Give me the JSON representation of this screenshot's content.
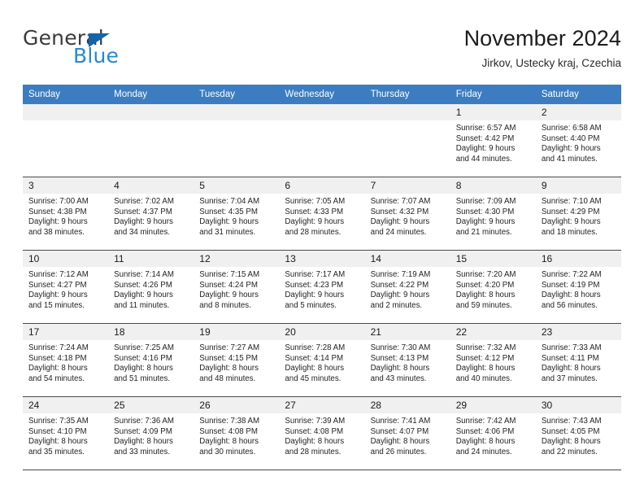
{
  "brand": {
    "name_part1": "General",
    "name_part2": "Blue",
    "accent_color": "#2389d4",
    "triangle_color": "#1464aa"
  },
  "header": {
    "title": "November 2024",
    "subtitle": "Jirkov, Ustecky kraj, Czechia"
  },
  "calendar": {
    "header_bg": "#3b7dc0",
    "daynum_bg": "#f0f0f0",
    "weekdays": [
      "Sunday",
      "Monday",
      "Tuesday",
      "Wednesday",
      "Thursday",
      "Friday",
      "Saturday"
    ],
    "labels": {
      "sunrise": "Sunrise:",
      "sunset": "Sunset:",
      "daylight": "Daylight:"
    },
    "weeks": [
      [
        {
          "day": "",
          "empty": true
        },
        {
          "day": "",
          "empty": true
        },
        {
          "day": "",
          "empty": true
        },
        {
          "day": "",
          "empty": true
        },
        {
          "day": "",
          "empty": true
        },
        {
          "day": "1",
          "sunrise": "Sunrise: 6:57 AM",
          "sunset": "Sunset: 4:42 PM",
          "daylight_line1": "Daylight: 9 hours",
          "daylight_line2": "and 44 minutes."
        },
        {
          "day": "2",
          "sunrise": "Sunrise: 6:58 AM",
          "sunset": "Sunset: 4:40 PM",
          "daylight_line1": "Daylight: 9 hours",
          "daylight_line2": "and 41 minutes."
        }
      ],
      [
        {
          "day": "3",
          "sunrise": "Sunrise: 7:00 AM",
          "sunset": "Sunset: 4:38 PM",
          "daylight_line1": "Daylight: 9 hours",
          "daylight_line2": "and 38 minutes."
        },
        {
          "day": "4",
          "sunrise": "Sunrise: 7:02 AM",
          "sunset": "Sunset: 4:37 PM",
          "daylight_line1": "Daylight: 9 hours",
          "daylight_line2": "and 34 minutes."
        },
        {
          "day": "5",
          "sunrise": "Sunrise: 7:04 AM",
          "sunset": "Sunset: 4:35 PM",
          "daylight_line1": "Daylight: 9 hours",
          "daylight_line2": "and 31 minutes."
        },
        {
          "day": "6",
          "sunrise": "Sunrise: 7:05 AM",
          "sunset": "Sunset: 4:33 PM",
          "daylight_line1": "Daylight: 9 hours",
          "daylight_line2": "and 28 minutes."
        },
        {
          "day": "7",
          "sunrise": "Sunrise: 7:07 AM",
          "sunset": "Sunset: 4:32 PM",
          "daylight_line1": "Daylight: 9 hours",
          "daylight_line2": "and 24 minutes."
        },
        {
          "day": "8",
          "sunrise": "Sunrise: 7:09 AM",
          "sunset": "Sunset: 4:30 PM",
          "daylight_line1": "Daylight: 9 hours",
          "daylight_line2": "and 21 minutes."
        },
        {
          "day": "9",
          "sunrise": "Sunrise: 7:10 AM",
          "sunset": "Sunset: 4:29 PM",
          "daylight_line1": "Daylight: 9 hours",
          "daylight_line2": "and 18 minutes."
        }
      ],
      [
        {
          "day": "10",
          "sunrise": "Sunrise: 7:12 AM",
          "sunset": "Sunset: 4:27 PM",
          "daylight_line1": "Daylight: 9 hours",
          "daylight_line2": "and 15 minutes."
        },
        {
          "day": "11",
          "sunrise": "Sunrise: 7:14 AM",
          "sunset": "Sunset: 4:26 PM",
          "daylight_line1": "Daylight: 9 hours",
          "daylight_line2": "and 11 minutes."
        },
        {
          "day": "12",
          "sunrise": "Sunrise: 7:15 AM",
          "sunset": "Sunset: 4:24 PM",
          "daylight_line1": "Daylight: 9 hours",
          "daylight_line2": "and 8 minutes."
        },
        {
          "day": "13",
          "sunrise": "Sunrise: 7:17 AM",
          "sunset": "Sunset: 4:23 PM",
          "daylight_line1": "Daylight: 9 hours",
          "daylight_line2": "and 5 minutes."
        },
        {
          "day": "14",
          "sunrise": "Sunrise: 7:19 AM",
          "sunset": "Sunset: 4:22 PM",
          "daylight_line1": "Daylight: 9 hours",
          "daylight_line2": "and 2 minutes."
        },
        {
          "day": "15",
          "sunrise": "Sunrise: 7:20 AM",
          "sunset": "Sunset: 4:20 PM",
          "daylight_line1": "Daylight: 8 hours",
          "daylight_line2": "and 59 minutes."
        },
        {
          "day": "16",
          "sunrise": "Sunrise: 7:22 AM",
          "sunset": "Sunset: 4:19 PM",
          "daylight_line1": "Daylight: 8 hours",
          "daylight_line2": "and 56 minutes."
        }
      ],
      [
        {
          "day": "17",
          "sunrise": "Sunrise: 7:24 AM",
          "sunset": "Sunset: 4:18 PM",
          "daylight_line1": "Daylight: 8 hours",
          "daylight_line2": "and 54 minutes."
        },
        {
          "day": "18",
          "sunrise": "Sunrise: 7:25 AM",
          "sunset": "Sunset: 4:16 PM",
          "daylight_line1": "Daylight: 8 hours",
          "daylight_line2": "and 51 minutes."
        },
        {
          "day": "19",
          "sunrise": "Sunrise: 7:27 AM",
          "sunset": "Sunset: 4:15 PM",
          "daylight_line1": "Daylight: 8 hours",
          "daylight_line2": "and 48 minutes."
        },
        {
          "day": "20",
          "sunrise": "Sunrise: 7:28 AM",
          "sunset": "Sunset: 4:14 PM",
          "daylight_line1": "Daylight: 8 hours",
          "daylight_line2": "and 45 minutes."
        },
        {
          "day": "21",
          "sunrise": "Sunrise: 7:30 AM",
          "sunset": "Sunset: 4:13 PM",
          "daylight_line1": "Daylight: 8 hours",
          "daylight_line2": "and 43 minutes."
        },
        {
          "day": "22",
          "sunrise": "Sunrise: 7:32 AM",
          "sunset": "Sunset: 4:12 PM",
          "daylight_line1": "Daylight: 8 hours",
          "daylight_line2": "and 40 minutes."
        },
        {
          "day": "23",
          "sunrise": "Sunrise: 7:33 AM",
          "sunset": "Sunset: 4:11 PM",
          "daylight_line1": "Daylight: 8 hours",
          "daylight_line2": "and 37 minutes."
        }
      ],
      [
        {
          "day": "24",
          "sunrise": "Sunrise: 7:35 AM",
          "sunset": "Sunset: 4:10 PM",
          "daylight_line1": "Daylight: 8 hours",
          "daylight_line2": "and 35 minutes."
        },
        {
          "day": "25",
          "sunrise": "Sunrise: 7:36 AM",
          "sunset": "Sunset: 4:09 PM",
          "daylight_line1": "Daylight: 8 hours",
          "daylight_line2": "and 33 minutes."
        },
        {
          "day": "26",
          "sunrise": "Sunrise: 7:38 AM",
          "sunset": "Sunset: 4:08 PM",
          "daylight_line1": "Daylight: 8 hours",
          "daylight_line2": "and 30 minutes."
        },
        {
          "day": "27",
          "sunrise": "Sunrise: 7:39 AM",
          "sunset": "Sunset: 4:08 PM",
          "daylight_line1": "Daylight: 8 hours",
          "daylight_line2": "and 28 minutes."
        },
        {
          "day": "28",
          "sunrise": "Sunrise: 7:41 AM",
          "sunset": "Sunset: 4:07 PM",
          "daylight_line1": "Daylight: 8 hours",
          "daylight_line2": "and 26 minutes."
        },
        {
          "day": "29",
          "sunrise": "Sunrise: 7:42 AM",
          "sunset": "Sunset: 4:06 PM",
          "daylight_line1": "Daylight: 8 hours",
          "daylight_line2": "and 24 minutes."
        },
        {
          "day": "30",
          "sunrise": "Sunrise: 7:43 AM",
          "sunset": "Sunset: 4:05 PM",
          "daylight_line1": "Daylight: 8 hours",
          "daylight_line2": "and 22 minutes."
        }
      ]
    ]
  }
}
